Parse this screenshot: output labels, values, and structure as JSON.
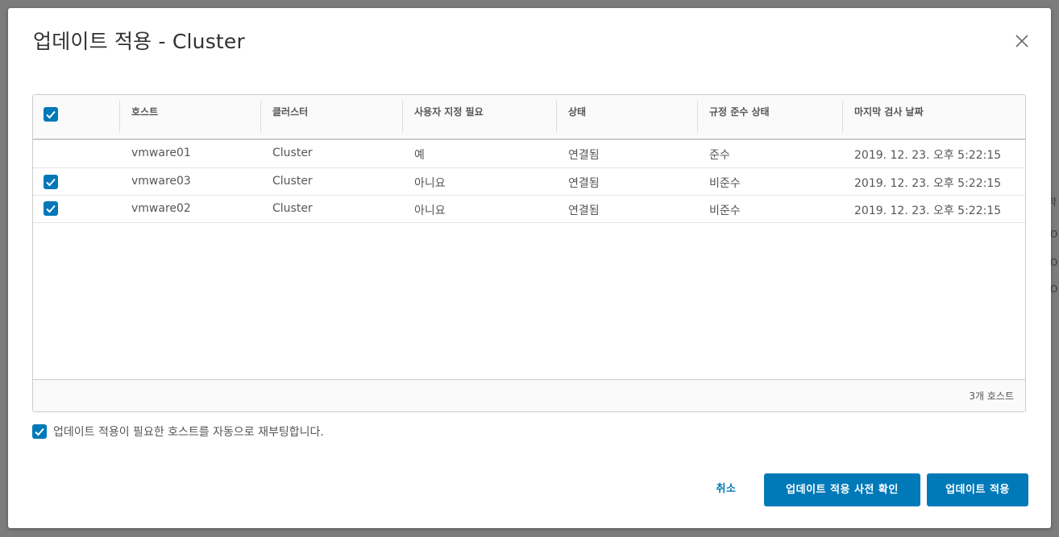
{
  "dialog": {
    "title": "업데이트 적용 - Cluster"
  },
  "background_fragments": [
    "약",
    "O",
    "O",
    "O"
  ],
  "table": {
    "columns": [
      "호스트",
      "클러스터",
      "사용자 지정 필요",
      "상태",
      "규정 준수 상태",
      "마지막 검사 날짜"
    ],
    "select_all_checked": true,
    "rows": [
      {
        "checked": false,
        "host": "vmware01",
        "cluster": "Cluster",
        "custom_required": "예",
        "status": "연결됨",
        "compliance": "준수",
        "last_scan": "2019. 12. 23. 오후 5:22:15"
      },
      {
        "checked": true,
        "host": "vmware03",
        "cluster": "Cluster",
        "custom_required": "아니요",
        "status": "연결됨",
        "compliance": "비준수",
        "last_scan": "2019. 12. 23. 오후 5:22:15"
      },
      {
        "checked": true,
        "host": "vmware02",
        "cluster": "Cluster",
        "custom_required": "아니요",
        "status": "연결됨",
        "compliance": "비준수",
        "last_scan": "2019. 12. 23. 오후 5:22:15"
      }
    ],
    "footer_count": "3개 호스트"
  },
  "reboot_option": {
    "checked": true,
    "label": "업데이트 적용이 필요한 호스트를 자동으로 재부팅합니다."
  },
  "buttons": {
    "cancel": "취소",
    "precheck": "업데이트 적용 사전 확인",
    "apply": "업데이트 적용"
  },
  "colors": {
    "accent": "#0079b8",
    "overlay": "#7c7c7c"
  }
}
